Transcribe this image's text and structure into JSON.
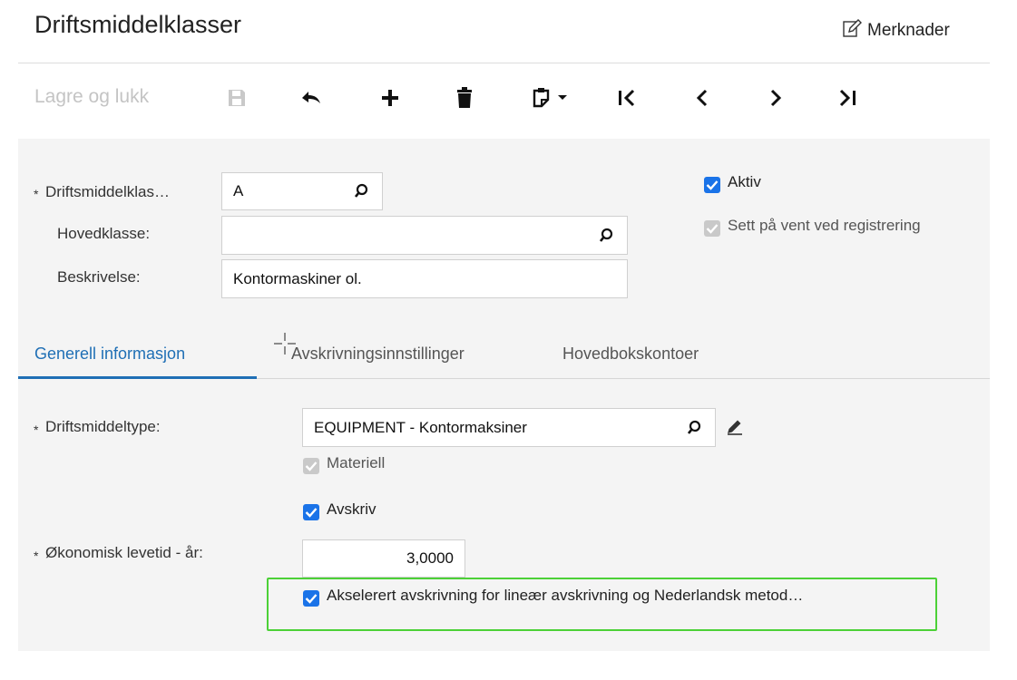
{
  "header": {
    "title": "Driftsmiddelklasser",
    "notes_label": "Merknader"
  },
  "toolbar": {
    "save_close_label": "Lagre og lukk"
  },
  "form": {
    "class_id": {
      "label": "Driftsmiddelklas…",
      "value": "A",
      "required_mark": "*"
    },
    "parent_class": {
      "label": "Hovedklasse:",
      "value": ""
    },
    "description": {
      "label": "Beskrivelse:",
      "value": "Kontormaskiner ol."
    },
    "active": {
      "label": "Aktiv",
      "checked": true
    },
    "hold_on_entry": {
      "label": "Sett på vent ved registrering",
      "checked": true,
      "disabled": true
    }
  },
  "tabs": [
    {
      "label": "Generell informasjon",
      "active": true
    },
    {
      "label": "Avskrivningsinnstillinger",
      "active": false
    },
    {
      "label": "Hovedbokskontoer",
      "active": false
    }
  ],
  "general": {
    "asset_type": {
      "label": "Driftsmiddeltype:",
      "value": "EQUIPMENT - Kontormaksiner",
      "required_mark": "*"
    },
    "tangible": {
      "label": "Materiell",
      "checked": true,
      "disabled": true
    },
    "depreciate": {
      "label": "Avskriv",
      "checked": true
    },
    "useful_life": {
      "label": "Økonomisk levetid - år:",
      "value": "3,0000",
      "required_mark": "*"
    },
    "accelerated": {
      "label": "Akselerert avskrivning for lineær avskrivning og Nederlandsk metod…",
      "checked": true
    }
  },
  "colors": {
    "accent": "#1f6fb5",
    "checkbox": "#1a73e8",
    "highlight": "#4cd137"
  }
}
